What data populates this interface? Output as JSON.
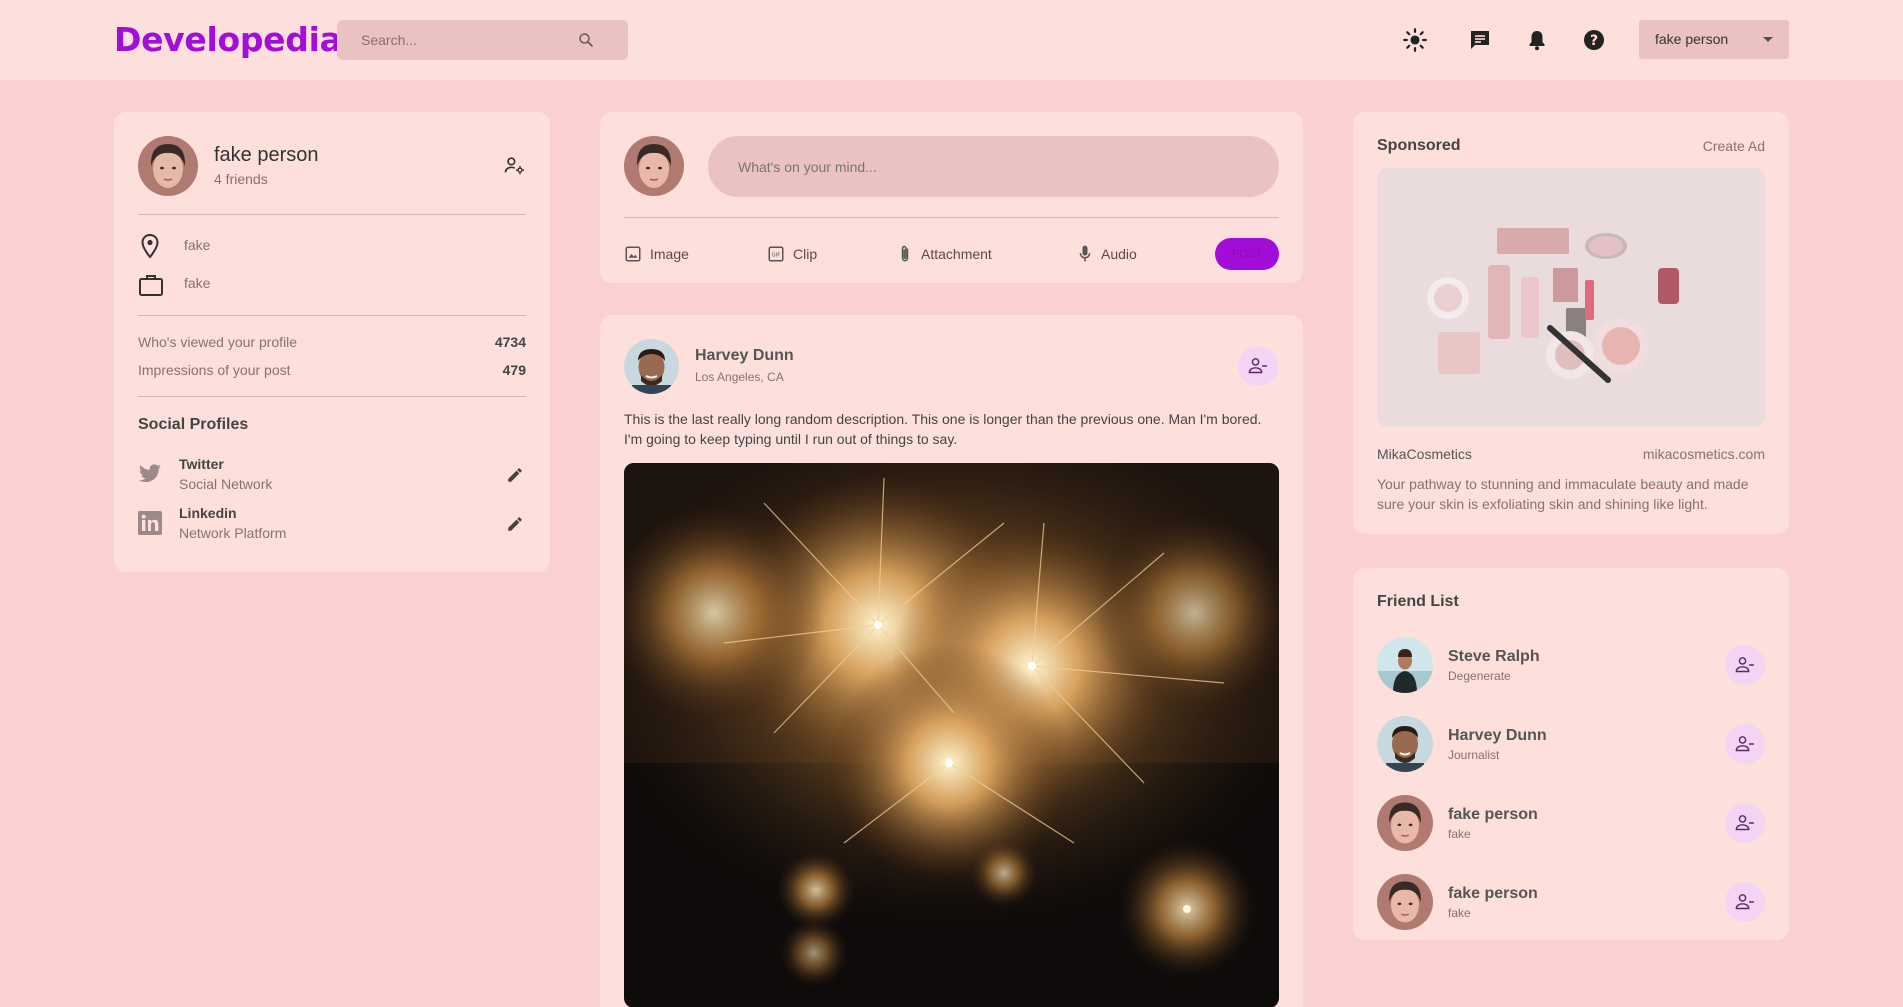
{
  "nav": {
    "logo": "Developedia",
    "search_placeholder": "Search...",
    "icons": [
      "search-icon",
      "light-mode-icon",
      "message-icon",
      "notification-icon",
      "help-icon"
    ],
    "user_select": "fake person"
  },
  "profile": {
    "name": "fake person",
    "friends": "4 friends",
    "location": "fake",
    "occupation": "fake",
    "stats": [
      {
        "label": "Who's viewed your profile",
        "value": "4734"
      },
      {
        "label": "Impressions of your post",
        "value": "479"
      }
    ],
    "social_title": "Social Profiles",
    "socials": [
      {
        "name": "Twitter",
        "type": "Social Network"
      },
      {
        "name": "Linkedin",
        "type": "Network Platform"
      }
    ]
  },
  "composer": {
    "placeholder": "What's on your mind...",
    "actions": [
      "Image",
      "Clip",
      "Attachment",
      "Audio"
    ],
    "post_label": "POST"
  },
  "post": {
    "author": "Harvey Dunn",
    "location": "Los Angeles, CA",
    "text": "This is the last really long random description. This one is longer than the previous one. Man I'm bored. I'm going to keep typing until I run out of things to say."
  },
  "ad": {
    "title": "Sponsored",
    "create_label": "Create Ad",
    "brand": "MikaCosmetics",
    "url": "mikacosmetics.com",
    "description": "Your pathway to stunning and immaculate beauty and made sure your skin is exfoliating skin and shining like light."
  },
  "friend_list": {
    "title": "Friend List",
    "friends": [
      {
        "name": "Steve Ralph",
        "subtitle": "Degenerate"
      },
      {
        "name": "Harvey Dunn",
        "subtitle": "Journalist"
      },
      {
        "name": "fake person",
        "subtitle": "fake"
      },
      {
        "name": "fake person",
        "subtitle": "fake"
      }
    ]
  },
  "colors": {
    "background": "#fad0d0",
    "card": "#fde0dc",
    "accent": "#a20ed8",
    "input": "#ebc2c2"
  }
}
